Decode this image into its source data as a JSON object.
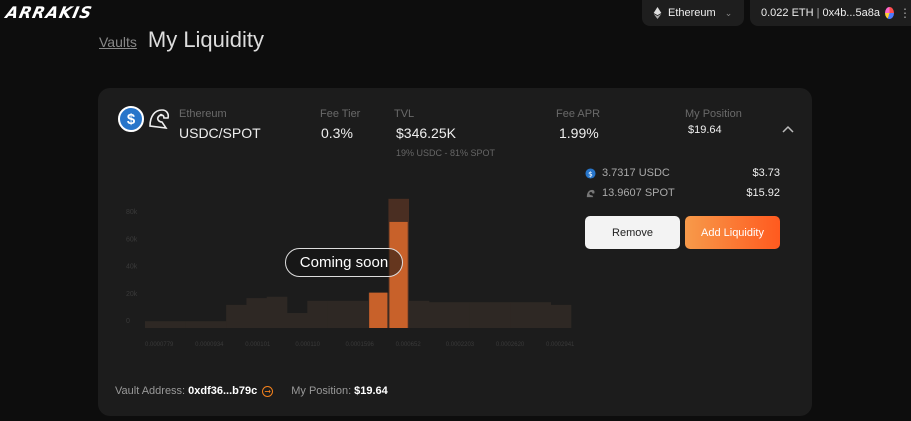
{
  "header": {
    "logo_text": "ARRAKIS",
    "network": {
      "label": "Ethereum",
      "icon": "eth-icon"
    },
    "account": {
      "balance": "0.022 ETH",
      "address": "0x4b...5a8a"
    }
  },
  "breadcrumb": {
    "parent": "Vaults",
    "title": "My Liquidity"
  },
  "vault": {
    "network": "Ethereum",
    "pair": "USDC/SPOT",
    "fee_tier_label": "Fee Tier",
    "fee_tier": "0.3%",
    "tvl_label": "TVL",
    "tvl": "$346.25K",
    "tvl_split": "19% USDC - 81% SPOT",
    "fee_apr_label": "Fee APR",
    "fee_apr": "1.99%",
    "position_label": "My Position",
    "position": "$19.64",
    "holdings": [
      {
        "amount": "3.7317 USDC",
        "value": "$3.73",
        "icon": "usdc-icon"
      },
      {
        "amount": "13.9607 SPOT",
        "value": "$15.92",
        "icon": "spot-icon"
      }
    ],
    "remove_label": "Remove",
    "add_label": "Add Liquidity",
    "coming_soon": "Coming soon",
    "footer": {
      "address_label": "Vault Address:",
      "address": "0xdf36...b79c",
      "position_label": "My Position:",
      "position": "$19.64"
    }
  },
  "chart_data": {
    "type": "bar",
    "title": "",
    "xlabel": "",
    "ylabel": "",
    "yticks": [
      "0",
      "20k",
      "40k",
      "60k",
      "80k"
    ],
    "ylim": [
      0,
      100000
    ],
    "xticks": [
      "0.0000779",
      "0.0000934",
      "0.000101",
      "0.000110",
      "0.0001596",
      "0.000652",
      "0.0002203",
      "0.0002620",
      "0.0002941"
    ],
    "values": [
      5000,
      5000,
      5000,
      5000,
      17000,
      22000,
      23000,
      11000,
      20000,
      20000,
      20000,
      26000,
      95000,
      20000,
      19000,
      19000,
      19000,
      19000,
      19000,
      19000,
      17000
    ],
    "active_values": [
      0,
      0,
      0,
      0,
      0,
      0,
      0,
      0,
      0,
      0,
      0,
      26000,
      78000,
      0,
      0,
      0,
      0,
      0,
      0,
      0,
      0
    ],
    "colors": {
      "bar": "#2e2824",
      "active": "#c8612a",
      "overflow": "#4a2e22"
    }
  }
}
